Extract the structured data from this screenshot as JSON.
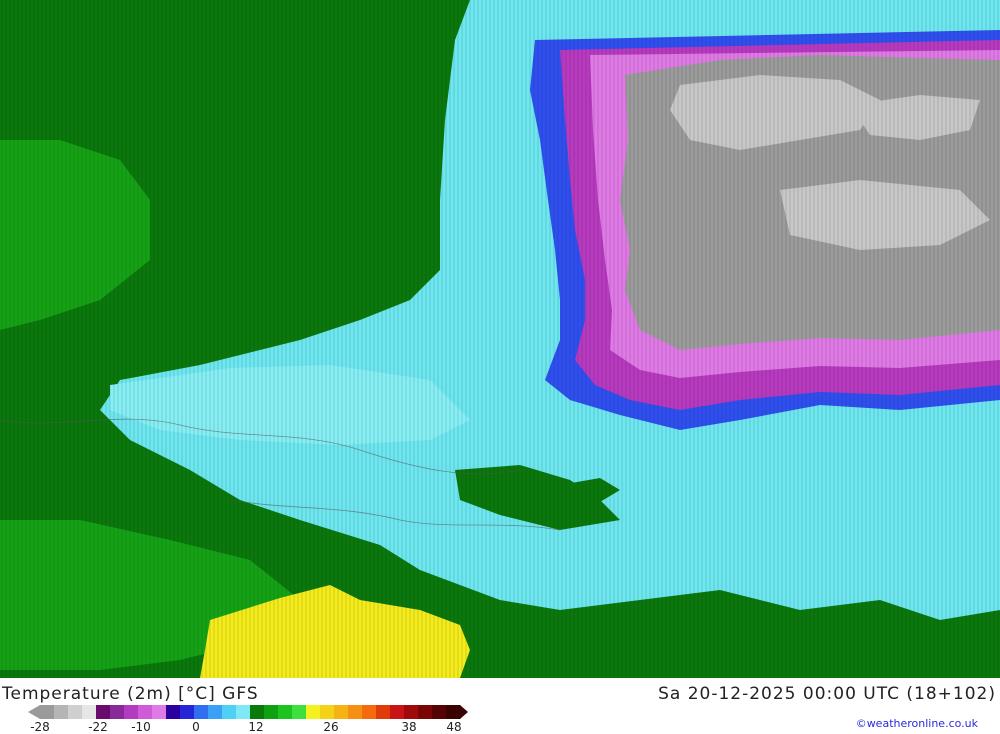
{
  "title": {
    "left": "Temperature (2m) [°C] GFS",
    "right": "Sa 20-12-2025 00:00 UTC (18+102)"
  },
  "credit": "©weatheronline.co.uk",
  "legend": {
    "ticks": [
      "-28",
      "-22",
      "-10",
      "0",
      "12",
      "26",
      "38",
      "48"
    ],
    "colors": [
      "#9a9a9a",
      "#b5b5b5",
      "#cfcfcf",
      "#e6e6e6",
      "#6a0a6a",
      "#8a2a9a",
      "#b23bc0",
      "#d05bd6",
      "#e07ae6",
      "#2a00a0",
      "#2626d6",
      "#2f6ef0",
      "#3aa0f5",
      "#4fd0f5",
      "#7ee8f5",
      "#0a7a0a",
      "#11a011",
      "#1ec41e",
      "#3de03d",
      "#f5f020",
      "#f5d21a",
      "#f5b414",
      "#f59014",
      "#f56a0f",
      "#e03c0a",
      "#c81414",
      "#a00a0a",
      "#7a0505",
      "#580303",
      "#3a0202"
    ]
  },
  "map_colors": {
    "dark_green": "#0a780c",
    "mid_green": "#15a315",
    "cyan": "#6ee8f0",
    "light_cyan": "#86f0f5",
    "blue": "#2f4ff0",
    "magenta": "#b83ac0",
    "pink": "#e07ae6",
    "grey": "#9c9c9c",
    "light_grey": "#c8c8c8",
    "yellow": "#f5ec1c"
  }
}
